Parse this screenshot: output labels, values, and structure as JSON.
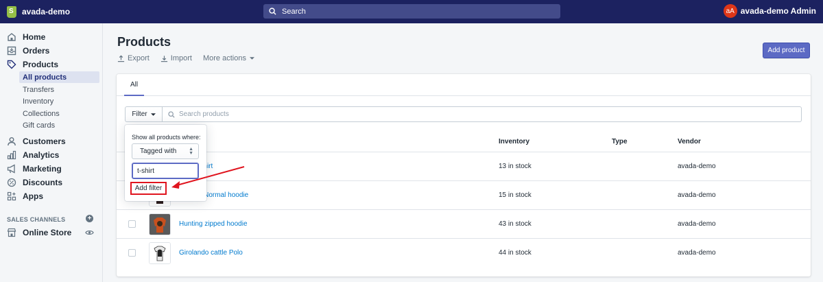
{
  "topbar": {
    "store_name": "avada-demo",
    "search_placeholder": "Search",
    "avatar_initials": "aA",
    "user_name": "avada-demo Admin"
  },
  "sidebar": {
    "items": [
      {
        "label": "Home",
        "icon": "home-icon"
      },
      {
        "label": "Orders",
        "icon": "orders-icon"
      },
      {
        "label": "Products",
        "icon": "tag-icon"
      }
    ],
    "product_subitems": [
      "All products",
      "Transfers",
      "Inventory",
      "Collections",
      "Gift cards"
    ],
    "items_lower": [
      {
        "label": "Customers",
        "icon": "person-icon"
      },
      {
        "label": "Analytics",
        "icon": "analytics-icon"
      },
      {
        "label": "Marketing",
        "icon": "megaphone-icon"
      },
      {
        "label": "Discounts",
        "icon": "discount-icon"
      },
      {
        "label": "Apps",
        "icon": "apps-icon"
      }
    ],
    "sales_channels_title": "SALES CHANNELS",
    "online_store": "Online Store"
  },
  "page": {
    "title": "Products",
    "export": "Export",
    "import": "Import",
    "more_actions": "More actions",
    "add_product": "Add product"
  },
  "tabs": [
    "All"
  ],
  "filter": {
    "button_label": "Filter",
    "search_placeholder": "Search products"
  },
  "popover": {
    "label": "Show all products where:",
    "select_value": "Tagged with",
    "input_value": "t-shirt",
    "add_filter": "Add filter"
  },
  "table": {
    "columns": [
      "Inventory",
      "Type",
      "Vendor"
    ],
    "rows": [
      {
        "name": "Frontier T-Shirt",
        "visible_name": "nter T-Shirt",
        "inventory": "13 in stock",
        "type": "",
        "vendor": "avada-demo"
      },
      {
        "name": "Foofighter Normal hoodie",
        "visible_name": "ofighter Normal hoodie",
        "inventory": "15 in stock",
        "type": "",
        "vendor": "avada-demo"
      },
      {
        "name": "Hunting zipped hoodie",
        "visible_name": "Hunting zipped hoodie",
        "inventory": "43 in stock",
        "type": "",
        "vendor": "avada-demo"
      },
      {
        "name": "Girolando cattle Polo",
        "visible_name": "Girolando cattle Polo",
        "inventory": "44 in stock",
        "type": "",
        "vendor": "avada-demo"
      }
    ]
  },
  "colors": {
    "topbar": "#1c2260",
    "primary": "#5c6ac4",
    "link": "#007ace",
    "highlight": "#e0141e"
  }
}
